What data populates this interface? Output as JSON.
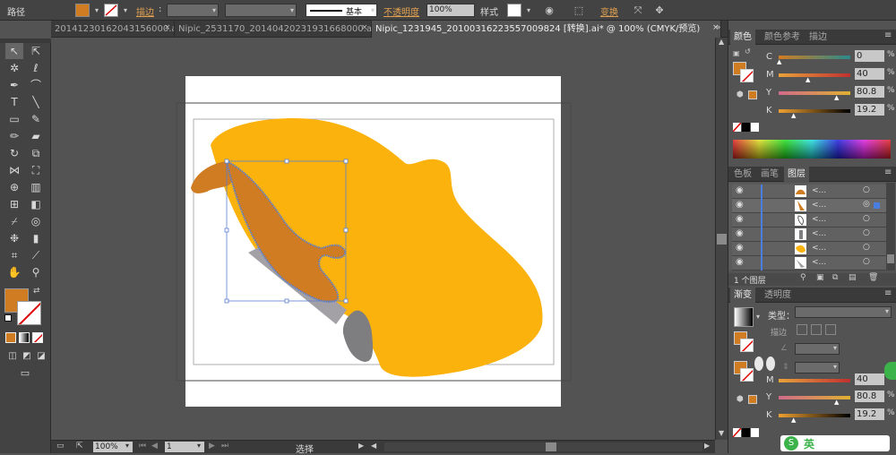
{
  "control_bar": {
    "context_label": "路径",
    "fill_color": "#d07c22",
    "stroke_label": "描边",
    "stroke_style_label": "基本",
    "opacity_label": "不透明度",
    "opacity_value": "100%",
    "style_label": "样式",
    "transform_label": "变换"
  },
  "tabs": [
    {
      "label": "2014123016204315600­0.ai*"
    },
    {
      "label": "Nipic_2531170_20140420231931668000.ai*"
    },
    {
      "label": "Nipic_1231945_20100316223557009824 [转换].ai* @ 100% (CMYK/预览)"
    }
  ],
  "status_bar": {
    "zoom": "100%",
    "page": "1",
    "tool_name": "选择"
  },
  "color_panel": {
    "tabs": [
      "颜色",
      "颜色参考",
      "描边"
    ],
    "channels": [
      {
        "label": "C",
        "value": "0"
      },
      {
        "label": "M",
        "value": "40"
      },
      {
        "label": "Y",
        "value": "80.8"
      },
      {
        "label": "K",
        "value": "19.2"
      }
    ]
  },
  "layers_panel": {
    "tabs": [
      "色板",
      "画笔",
      "图层"
    ],
    "rows": [
      {
        "name": "<..."
      },
      {
        "name": "<..."
      },
      {
        "name": "<..."
      },
      {
        "name": "<..."
      },
      {
        "name": "<..."
      },
      {
        "name": "<..."
      }
    ],
    "footer": "1 个图层"
  },
  "gradient_panel": {
    "tabs": [
      "渐变",
      "透明度"
    ],
    "type_label": "类型：",
    "stroke_label": "描边",
    "channels": [
      {
        "label": "M",
        "value": "40"
      },
      {
        "label": "Y",
        "value": "80.8"
      },
      {
        "label": "K",
        "value": "19.2"
      }
    ]
  },
  "watermark": "英"
}
